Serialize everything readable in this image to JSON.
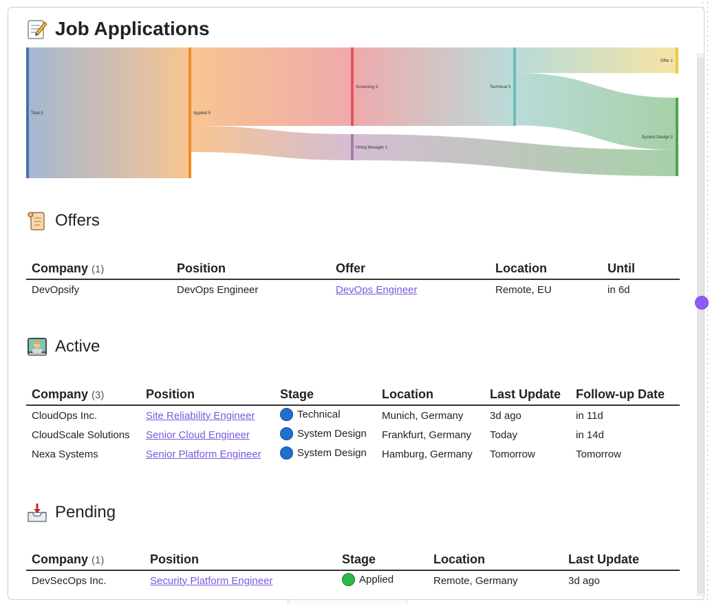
{
  "page": {
    "title": "Job Applications"
  },
  "sankey": {
    "nodes": [
      "Total 5",
      "Applied 5",
      "Screening 3",
      "Hiring Manager 1",
      "Technical 3",
      "Offer 1",
      "System Design 2"
    ],
    "links": [
      {
        "source": "Total 5",
        "target": "Applied 5",
        "value": 5
      },
      {
        "source": "Applied 5",
        "target": "Screening 3",
        "value": 3
      },
      {
        "source": "Applied 5",
        "target": "Hiring Manager 1",
        "value": 1
      },
      {
        "source": "Screening 3",
        "target": "Technical 3",
        "value": 3
      },
      {
        "source": "Technical 3",
        "target": "Offer 1",
        "value": 1
      },
      {
        "source": "Technical 3",
        "target": "System Design 2",
        "value": 2
      },
      {
        "source": "Hiring Manager 1",
        "target": "System Design 2",
        "value": 1
      }
    ],
    "colors": {
      "Total 5": "#4a6fa5",
      "Applied 5": "#f08a24",
      "Screening 3": "#e0555a",
      "Hiring Manager 1": "#a97aa6",
      "Technical 3": "#72b8b3",
      "Offer 1": "#ecc84a",
      "System Design 2": "#4fa24f"
    }
  },
  "offers": {
    "heading": "Offers",
    "columns": {
      "company": "Company",
      "count": "(1)",
      "position": "Position",
      "offer": "Offer",
      "location": "Location",
      "until": "Until"
    },
    "rows": [
      {
        "company": "DevOpsify",
        "position": "DevOps Engineer",
        "offer": "DevOps Engineer",
        "location": "Remote, EU",
        "until": "in 6d"
      }
    ]
  },
  "active": {
    "heading": "Active",
    "columns": {
      "company": "Company",
      "count": "(3)",
      "position": "Position",
      "stage": "Stage",
      "location": "Location",
      "last_update": "Last Update",
      "follow_up": "Follow-up Date"
    },
    "rows": [
      {
        "company": "CloudOps Inc.",
        "position": "Site Reliability Engineer",
        "stage": "Technical",
        "location": "Munich, Germany",
        "last_update": "3d ago",
        "follow_up": "in 11d"
      },
      {
        "company": "CloudScale Solutions",
        "position": "Senior Cloud Engineer",
        "stage": "System Design",
        "location": "Frankfurt, Germany",
        "last_update": "Today",
        "follow_up": "in 14d"
      },
      {
        "company": "Nexa Systems",
        "position": "Senior Platform Engineer",
        "stage": "System Design",
        "location": "Hamburg, Germany",
        "last_update": "Tomorrow",
        "follow_up": "Tomorrow"
      }
    ]
  },
  "pending": {
    "heading": "Pending",
    "columns": {
      "company": "Company",
      "count": "(1)",
      "position": "Position",
      "stage": "Stage",
      "location": "Location",
      "last_update": "Last Update"
    },
    "rows": [
      {
        "company": "DevSecOps Inc.",
        "position": "Security Platform Engineer",
        "stage": "Applied",
        "location": "Remote, Germany",
        "last_update": "3d ago"
      }
    ]
  },
  "icons": {
    "title": "memo-icon",
    "offers": "scroll-icon",
    "active": "technologist-icon",
    "pending": "inbox-tray-icon",
    "stage_active": "blue-circle-icon",
    "stage_pending": "green-circle-icon"
  }
}
